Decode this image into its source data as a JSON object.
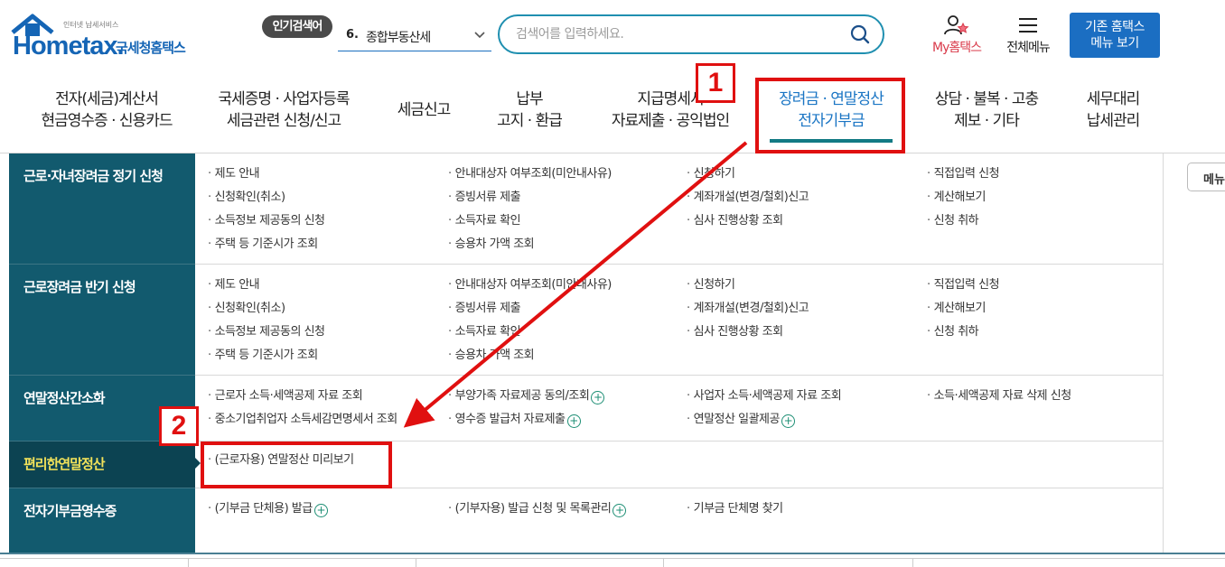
{
  "header": {
    "logo": {
      "tagline": "인터넷 납세서비스",
      "brand": "Hometax.",
      "brand_kr": "국세청홈택스"
    },
    "popular_search": {
      "label": "인기검색어",
      "rank": "6.",
      "term": "종합부동산세"
    },
    "search": {
      "placeholder": "검색어를 입력하세요."
    },
    "my_hometax": "My홈택스",
    "all_menu": "전체메뉴",
    "legacy_button": {
      "line1": "기존 홈택스",
      "line2": "메뉴 보기"
    }
  },
  "gnb": [
    {
      "line1": "전자(세금)계산서",
      "line2": "현금영수증 · 신용카드"
    },
    {
      "line1": "국세증명 · 사업자등록",
      "line2": "세금관련 신청/신고"
    },
    {
      "line1": "세금신고",
      "line2": ""
    },
    {
      "line1": "납부",
      "line2": "고지 · 환급"
    },
    {
      "line1": "지급명세서",
      "line2": "자료제출 · 공익법인"
    },
    {
      "line1": "장려금 · 연말정산",
      "line2": "전자기부금",
      "active": true
    },
    {
      "line1": "상담 · 불복 · 고충",
      "line2": "제보 · 기타"
    },
    {
      "line1": "세무대리",
      "line2": "납세관리"
    }
  ],
  "sections": [
    {
      "title": "근로·자녀장려금 정기 신청",
      "links": [
        [
          "제도 안내",
          "안내대상자 여부조회(미안내사유)",
          "신청하기",
          "직접입력 신청"
        ],
        [
          "신청확인(취소)",
          "증빙서류 제출",
          "계좌개설(변경/철회)신고",
          "계산해보기"
        ],
        [
          "소득정보 제공동의 신청",
          "소득자료 확인",
          "심사 진행상황 조회",
          "신청 취하"
        ],
        [
          "주택 등 기준시가 조회",
          "승용차 가액 조회"
        ]
      ]
    },
    {
      "title": "근로장려금 반기 신청",
      "links": [
        [
          "제도 안내",
          "안내대상자 여부조회(미안내사유)",
          "신청하기",
          "직접입력 신청"
        ],
        [
          "신청확인(취소)",
          "증빙서류 제출",
          "계좌개설(변경/철회)신고",
          "계산해보기"
        ],
        [
          "소득정보 제공동의 신청",
          "소득자료 확인",
          "심사 진행상황 조회",
          "신청 취하"
        ],
        [
          "주택 등 기준시가 조회",
          "승용차 가액 조회"
        ]
      ]
    },
    {
      "title": "연말정산간소화",
      "links": [
        [
          "근로자 소득·세액공제 자료 조회",
          "부양가족 자료제공 동의/조회",
          "사업자 소득·세액공제 자료 조회",
          "소득·세액공제 자료 삭제 신청"
        ],
        [
          "중소기업취업자 소득세감면명세서 조회",
          "영수증 발급처 자료제출",
          "연말정산 일괄제공"
        ]
      ]
    },
    {
      "title": "편리한연말정산",
      "links": [
        [
          "(근로자용) 연말정산 미리보기"
        ]
      ]
    },
    {
      "title": "전자기부금영수증",
      "links": [
        [
          "(기부금 단체용) 발급",
          "(기부자용) 발급 신청 및 목록관리",
          "기부금 단체명 찾기"
        ]
      ]
    }
  ],
  "side_menu_button": "메뉴",
  "annotations": {
    "badge1": "1",
    "badge2": "2",
    "color": "#e01010"
  }
}
